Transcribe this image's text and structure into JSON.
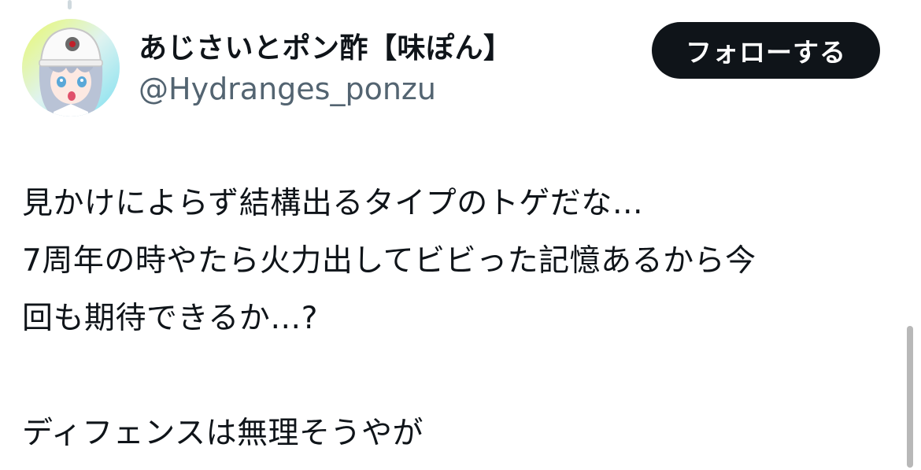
{
  "tweet": {
    "author": {
      "display_name": "あじさいとポン酢【味ぽん】",
      "handle": "@Hydranges_ponzu",
      "avatar_icon": "anime-girl-helmet-avatar"
    },
    "follow_button_label": "フォローする",
    "body_lines": [
      "見かけによらず結構出るタイプのトゲだな…",
      "7周年の時やたら火力出してビビった記憶あるから今",
      "回も期待できるか…?",
      "",
      "ディフェンスは無理そうやが"
    ]
  },
  "colors": {
    "text_primary": "#0f1419",
    "text_secondary": "#536471",
    "button_bg": "#0f1419",
    "button_text": "#ffffff",
    "background": "#ffffff"
  }
}
